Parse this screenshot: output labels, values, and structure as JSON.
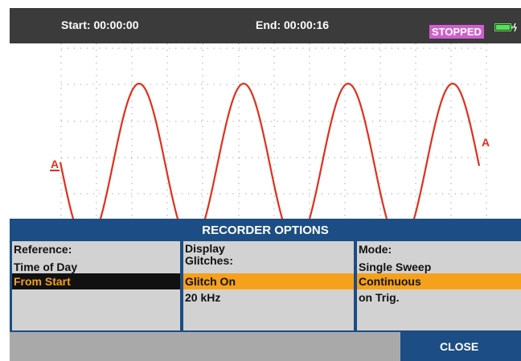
{
  "status_bar": {
    "start": "Start: 00:00:00",
    "end": "End: 00:00:16",
    "state": "STOPPED",
    "state_color": "#cf5fcf",
    "battery_icon": "battery-icon"
  },
  "trace": {
    "marker_left": "A",
    "marker_right": "A",
    "trace_color": "#e0301e",
    "grid": true
  },
  "menu": {
    "title": "RECORDER OPTIONS",
    "reference": {
      "header": "Reference:",
      "options": [
        "Time of Day",
        "From Start"
      ],
      "selected": "From Start"
    },
    "display": {
      "header_line1": "Display",
      "header_line2": "Glitches:",
      "options": [
        "Glitch On",
        "20 kHz"
      ],
      "selected": "Glitch On"
    },
    "mode": {
      "header": "Mode:",
      "options": [
        "Single Sweep",
        "Continuous",
        "on Trig."
      ],
      "selected": "Continuous"
    }
  },
  "softkeys": {
    "close": "CLOSE"
  },
  "colors": {
    "menu_blue": "#1c4d84",
    "highlight_orange": "#f5a11c",
    "panel_gray": "#d2d2d2"
  }
}
